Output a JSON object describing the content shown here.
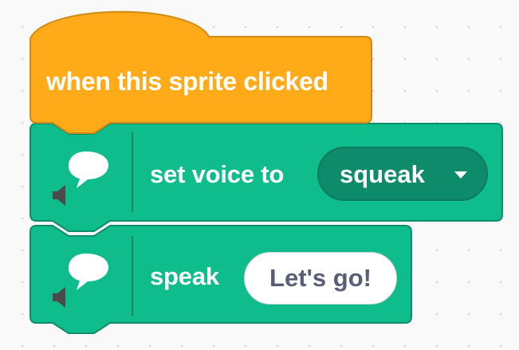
{
  "blocks": {
    "hat": {
      "label": "when this sprite clicked",
      "color": "#ffab19"
    },
    "set_voice": {
      "label": "set voice to",
      "dropdown_value": "squeak",
      "color": "#0fbd8c",
      "icon": "speech-bubble-speaker-icon"
    },
    "speak": {
      "label": "speak",
      "input_value": "Let's go!",
      "color": "#0fbd8c",
      "icon": "speech-bubble-speaker-icon"
    }
  },
  "colors": {
    "event_block": "#ffab19",
    "event_block_border": "#cf8b17",
    "extension_block": "#0fbd8c",
    "extension_block_border": "#0b8e69",
    "canvas_background": "#f9f9f9"
  }
}
